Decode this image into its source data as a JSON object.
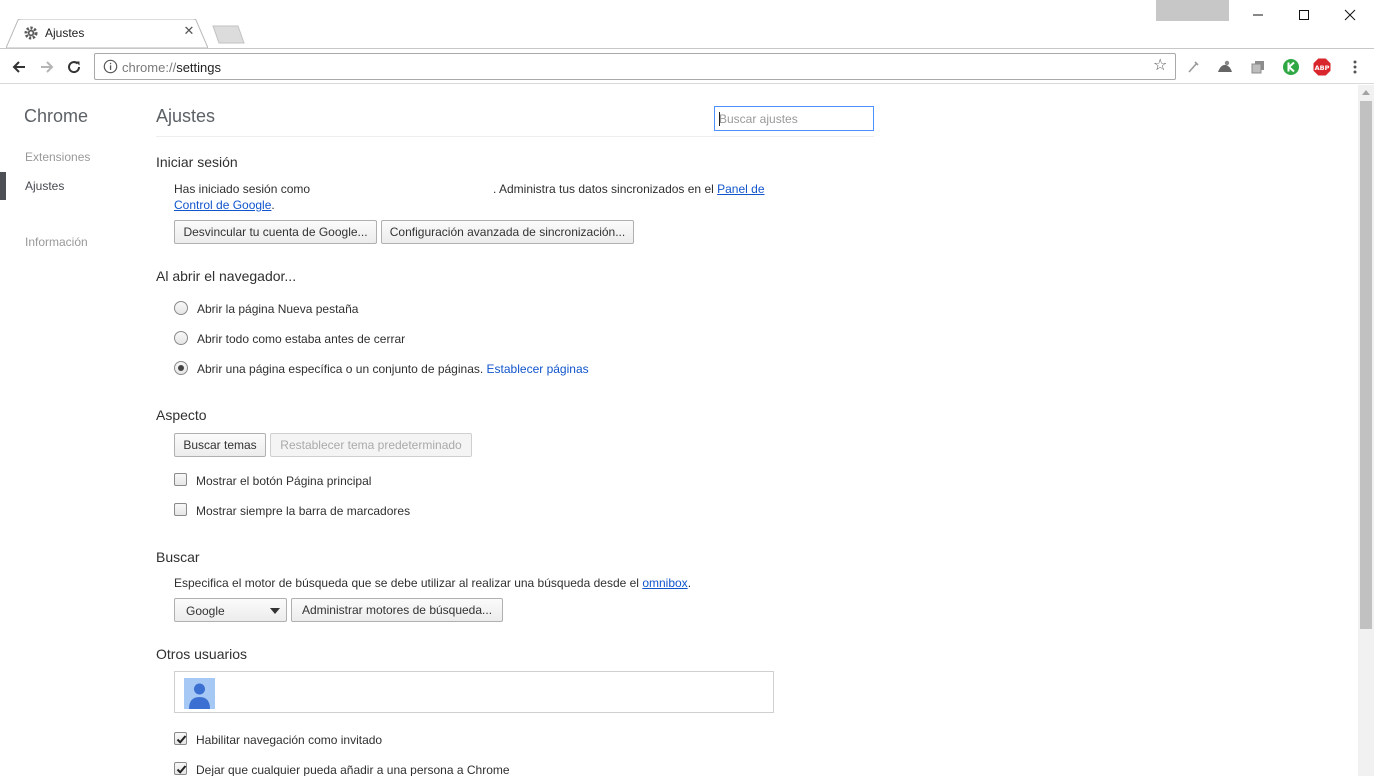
{
  "browser": {
    "tab": {
      "title": "Ajustes"
    },
    "omnibox": {
      "scheme": "chrome://",
      "path": "settings"
    }
  },
  "sidebar": {
    "brand": "Chrome",
    "items": [
      {
        "label": "Extensiones"
      },
      {
        "label": "Ajustes",
        "selected": true
      },
      {
        "label": "Información"
      }
    ]
  },
  "main": {
    "title": "Ajustes",
    "search_placeholder": "Buscar ajustes",
    "signin": {
      "title": "Iniciar sesión",
      "text_before": "Has iniciado sesión como",
      "text_after": ". Administra tus datos sincronizados en el",
      "link_line1": "Panel de",
      "link_line2": "Control de Google",
      "period": ".",
      "btn_disconnect": "Desvincular tu cuenta de Google...",
      "btn_advanced_sync": "Configuración avanzada de sincronización..."
    },
    "startup": {
      "title": "Al abrir el navegador...",
      "options": [
        {
          "label": "Abrir la página Nueva pestaña",
          "selected": false
        },
        {
          "label": "Abrir todo como estaba antes de cerrar",
          "selected": false
        },
        {
          "label": "Abrir una página específica o un conjunto de páginas.",
          "selected": true
        }
      ],
      "set_pages_link": "Establecer páginas"
    },
    "appearance": {
      "title": "Aspecto",
      "btn_themes": "Buscar temas",
      "btn_reset_theme": "Restablecer tema predeterminado",
      "checks": [
        {
          "label": "Mostrar el botón Página principal",
          "checked": false
        },
        {
          "label": "Mostrar siempre la barra de marcadores",
          "checked": false
        }
      ]
    },
    "search": {
      "title": "Buscar",
      "text": "Especifica el motor de búsqueda que se debe utilizar al realizar una búsqueda desde el",
      "link": "omnibox",
      "period": ".",
      "engine": "Google",
      "btn_manage": "Administrar motores de búsqueda..."
    },
    "users": {
      "title": "Otros usuarios",
      "checks": [
        {
          "label": "Habilitar navegación como invitado",
          "checked": true
        },
        {
          "label": "Dejar que cualquier pueda añadir a una persona a Chrome",
          "checked": true
        }
      ]
    }
  },
  "colors": {
    "link": "#1155cc",
    "focus_border": "#4d90fe",
    "abp_red": "#d9262d",
    "ext_green": "#2fa843"
  },
  "icons": [
    "gear-icon",
    "close-icon",
    "back-icon",
    "forward-icon",
    "reload-icon",
    "info-icon",
    "star-icon",
    "abp-icon",
    "menu-icon"
  ]
}
